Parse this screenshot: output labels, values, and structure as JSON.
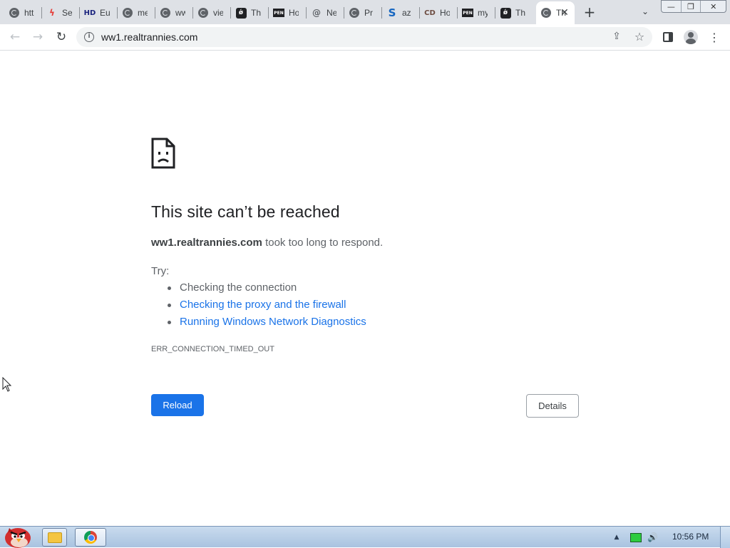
{
  "window": {
    "minimize_glyph": "—",
    "maximize_glyph": "❐",
    "close_glyph": "✕"
  },
  "tabs": [
    {
      "label": "htt",
      "favicon": "globe-icon"
    },
    {
      "label": "Se",
      "favicon": "red-bolt-icon",
      "glyph": "ϟ",
      "color": "#e53935"
    },
    {
      "label": "Eu",
      "favicon": "hd-icon",
      "glyph": "HD",
      "color": "#1a237e"
    },
    {
      "label": "me",
      "favicon": "globe-icon"
    },
    {
      "label": "ww",
      "favicon": "globe-icon"
    },
    {
      "label": "vie",
      "favicon": "globe-icon"
    },
    {
      "label": "Th",
      "favicon": "dark-square-icon",
      "glyph": "ǿ"
    },
    {
      "label": "Ho",
      "favicon": "pen-box-icon",
      "glyph": "PEN"
    },
    {
      "label": "Ne",
      "favicon": "at-sign-icon",
      "glyph": "@",
      "color": "#5f6368"
    },
    {
      "label": "Pr",
      "favicon": "globe-icon"
    },
    {
      "label": "az",
      "favicon": "s-icon",
      "glyph": "S",
      "color": "#1565c0"
    },
    {
      "label": "Ho",
      "favicon": "cd-icon",
      "glyph": "CD",
      "color": "#6d4c41"
    },
    {
      "label": "my",
      "favicon": "pen-box-icon",
      "glyph": "PEN"
    },
    {
      "label": "Th",
      "favicon": "dark-square-icon",
      "glyph": "ǿ"
    }
  ],
  "active_tab": {
    "label": "Th",
    "favicon": "globe-icon",
    "close": "✕"
  },
  "new_tab_glyph": "+",
  "tab_search_glyph": "⌄",
  "toolbar": {
    "back": "←",
    "forward": "→",
    "reload": "↻",
    "info_glyph": "i",
    "url": "ww1.realtrannies.com",
    "share": "⇪",
    "star": "☆",
    "menu": "⋮"
  },
  "error_page": {
    "title": "This site can’t be reached",
    "host": "ww1.realtrannies.com",
    "desc_rest": " took too long to respond.",
    "try_label": "Try:",
    "suggestions": [
      "Checking the connection",
      "Checking the proxy and the firewall",
      "Running Windows Network Diagnostics"
    ],
    "error_code": "ERR_CONNECTION_TIMED_OUT",
    "reload_button": "Reload",
    "details_button": "Details"
  },
  "taskbar": {
    "tray_arrow": "▲",
    "volume": "🔊",
    "clock": "10:56 PM"
  },
  "colors": {
    "link": "#1a73e8",
    "primary_button": "#1a73e8",
    "tab_strip": "#dee1e6"
  }
}
